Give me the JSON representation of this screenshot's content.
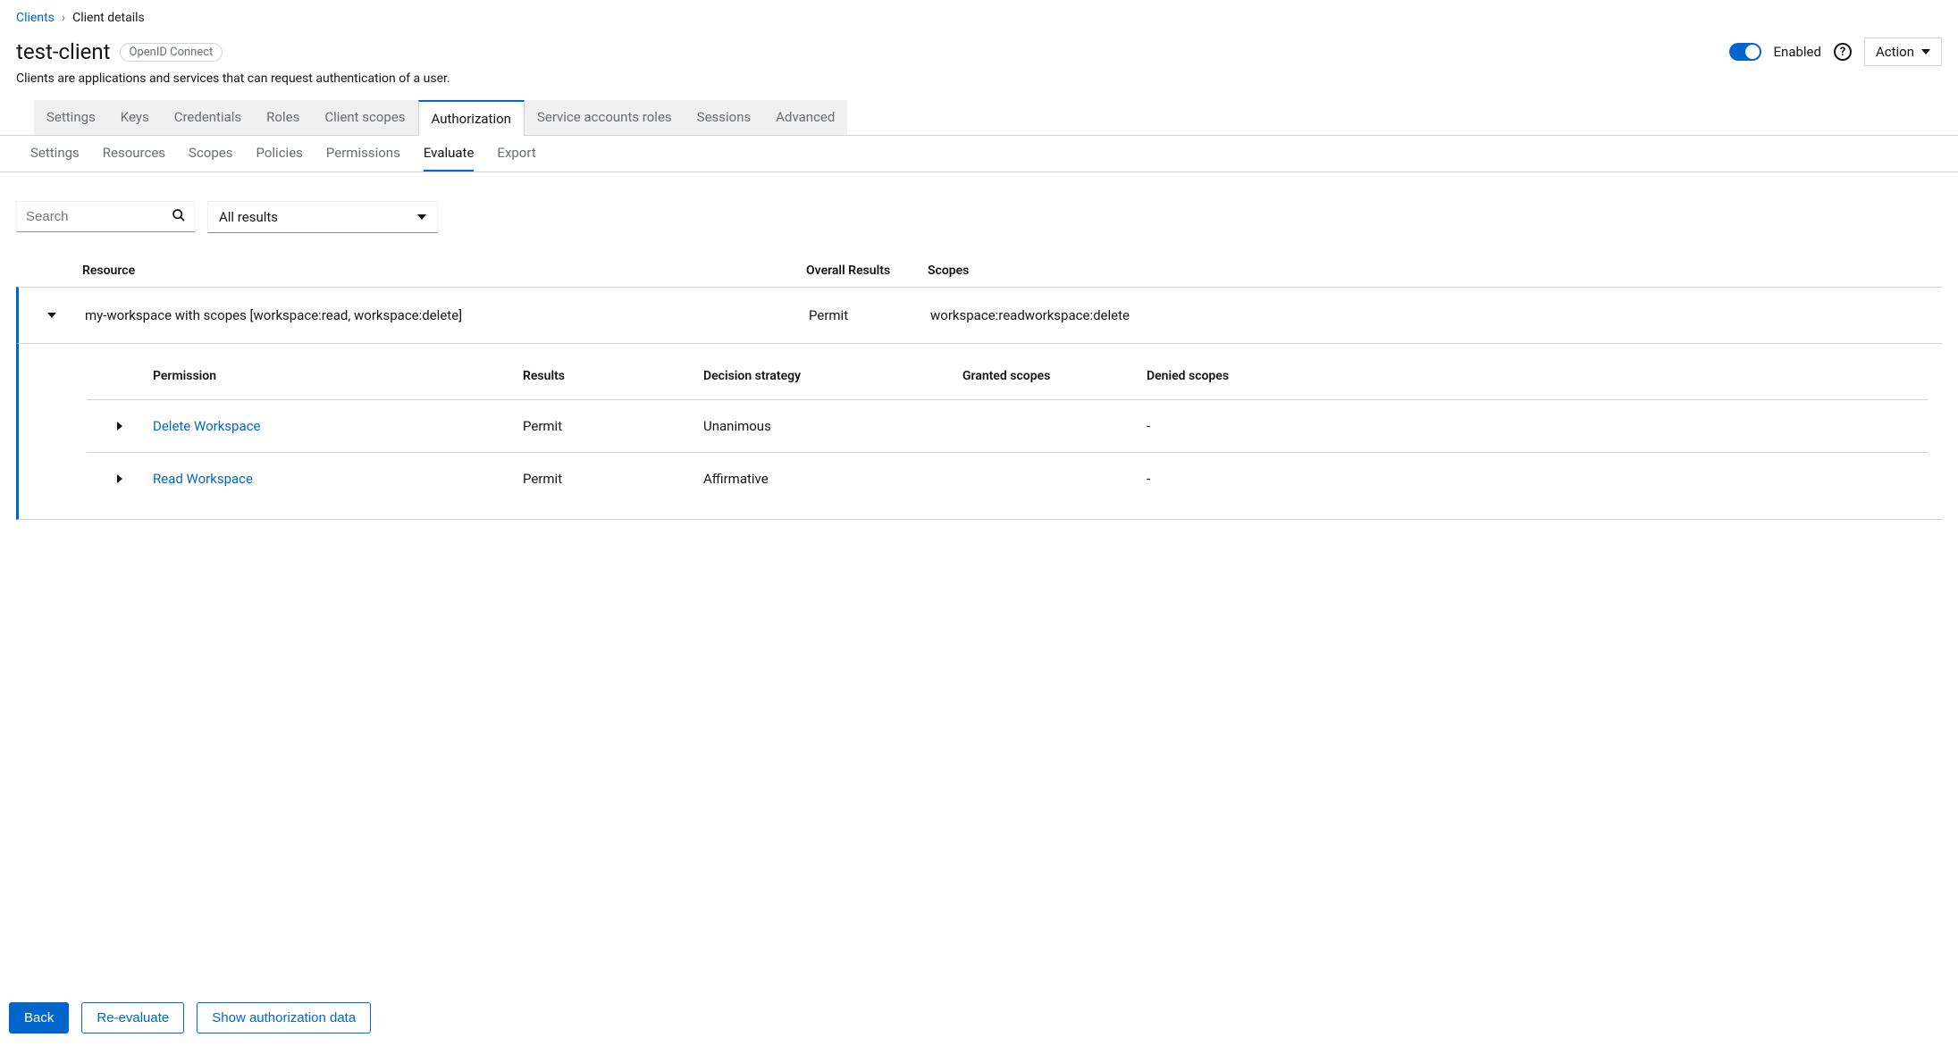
{
  "breadcrumb": {
    "root": "Clients",
    "current": "Client details"
  },
  "header": {
    "title": "test-client",
    "badge": "OpenID Connect",
    "description": "Clients are applications and services that can request authentication of a user.",
    "enabled_label": "Enabled",
    "action_label": "Action"
  },
  "tabs_primary": [
    "Settings",
    "Keys",
    "Credentials",
    "Roles",
    "Client scopes",
    "Authorization",
    "Service accounts roles",
    "Sessions",
    "Advanced"
  ],
  "tabs_primary_active": "Authorization",
  "tabs_secondary": [
    "Settings",
    "Resources",
    "Scopes",
    "Policies",
    "Permissions",
    "Evaluate",
    "Export"
  ],
  "tabs_secondary_active": "Evaluate",
  "toolbar": {
    "search_placeholder": "Search",
    "filter_selected": "All results"
  },
  "table": {
    "headers": {
      "resource": "Resource",
      "overall": "Overall Results",
      "scopes": "Scopes"
    },
    "row": {
      "resource": "my-workspace with scopes [workspace:read, workspace:delete]",
      "overall": "Permit",
      "scopes": "workspace:readworkspace:delete"
    }
  },
  "detail": {
    "headers": {
      "permission": "Permission",
      "results": "Results",
      "strategy": "Decision strategy",
      "granted": "Granted scopes",
      "denied": "Denied scopes"
    },
    "rows": [
      {
        "permission": "Delete Workspace",
        "results": "Permit",
        "strategy": "Unanimous",
        "granted": "",
        "denied": "-"
      },
      {
        "permission": "Read Workspace",
        "results": "Permit",
        "strategy": "Affirmative",
        "granted": "",
        "denied": "-"
      }
    ]
  },
  "footer": {
    "back": "Back",
    "reevaluate": "Re-evaluate",
    "show_auth": "Show authorization data"
  }
}
